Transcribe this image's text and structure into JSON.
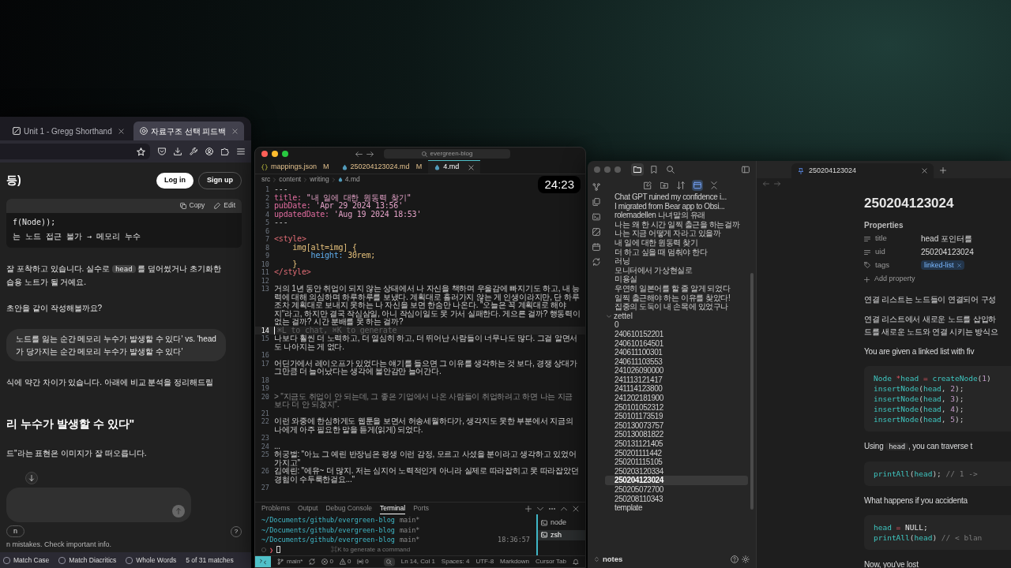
{
  "browser": {
    "tabs": [
      {
        "kind": "document",
        "title": "Unit 1 - Gregg Shorthand",
        "selected": false
      },
      {
        "kind": "chat",
        "title": "자료구조 선택 피드백",
        "selected": true
      }
    ],
    "chat_title": "등)",
    "header_buttons": [
      {
        "kind": "primary",
        "label": "Log in"
      },
      {
        "kind": "secondary",
        "label": "Sign up"
      }
    ],
    "conversation": [
      {
        "kind": "code_block",
        "actions": [
          {
            "kind": "copy",
            "label": "Copy"
          },
          {
            "kind": "edit",
            "label": "Edit"
          }
        ],
        "lines": [
          "f(Node));",
          "는 노드 접근 불가 → 메모리 누수"
        ]
      },
      {
        "kind": "paragraph",
        "lines": [
          [
            {
              "kind": "text",
              "text": "잘 포착하고 있습니다. 실수로 "
            },
            {
              "kind": "code",
              "text": "head"
            },
            {
              "kind": "text",
              "text": " 를 덮어썼거나 초기화한"
            }
          ],
          [
            {
              "kind": "text",
              "text": "습용 노트가 될 거예요."
            }
          ]
        ]
      },
      {
        "kind": "paragraph",
        "lines": [
          [
            {
              "kind": "text",
              "text": "초안을 같이 작성해볼까요?"
            }
          ]
        ]
      },
      {
        "kind": "user_bubble",
        "lines": [
          "노드를 잃는 순간 메모리 누수가 발생할 수 있다' vs. 'head",
          "가 당가지는 순간 메모리 누수가 발생할 수 있다'"
        ]
      },
      {
        "kind": "paragraph",
        "lines": [
          [
            {
              "kind": "text",
              "text": "식에 약간 차이가 있습니다. 아래에 비교 분석을 정리해드릴"
            }
          ]
        ]
      },
      {
        "kind": "heading",
        "lines": [
          "리 누수가 발생할 수 있다\""
        ]
      },
      {
        "kind": "paragraph",
        "lines": [
          [
            {
              "kind": "text",
              "text": "드\"라는 표현은 이미지가 잘 떠오릅니다."
            }
          ]
        ]
      }
    ],
    "composer_option": "n",
    "help_button": "?",
    "disclaimer": "n mistakes. Check important info.",
    "find_bar": {
      "options": [
        {
          "label": "Match Case",
          "checked": false
        },
        {
          "label": "Match Diacritics",
          "checked": false
        },
        {
          "label": "Whole Words",
          "checked": false
        }
      ],
      "status": "5 of 31 matches"
    }
  },
  "editor": {
    "search": "evergreen-blog",
    "tabs": [
      {
        "kind": "json",
        "label": "mappings.json",
        "badge": "M",
        "selected": false
      },
      {
        "kind": "markdown",
        "label": "250204123024.md",
        "badge": "M",
        "selected": false
      },
      {
        "kind": "markdown",
        "label": "4.md",
        "selected": true
      }
    ],
    "timer": "24:23",
    "breadcrumb": [
      {
        "kind": "folder",
        "label": "src"
      },
      {
        "kind": "folder",
        "label": "content"
      },
      {
        "kind": "folder",
        "label": "writing"
      },
      {
        "kind": "markdown",
        "label": "4.md"
      }
    ],
    "lines": [
      {
        "number": "1",
        "current": false,
        "tokens": [
          {
            "kind": "punct",
            "text": "---"
          }
        ]
      },
      {
        "number": "2",
        "current": false,
        "tokens": [
          {
            "kind": "key",
            "text": "title: "
          },
          {
            "kind": "string",
            "text": "\"내 일에 대한 원동력 찾기\""
          }
        ]
      },
      {
        "number": "3",
        "current": false,
        "tokens": [
          {
            "kind": "key",
            "text": "pubDate: "
          },
          {
            "kind": "string",
            "text": "'Apr 29 2024 13:56'"
          }
        ]
      },
      {
        "number": "4",
        "current": false,
        "tokens": [
          {
            "kind": "key",
            "text": "updatedDate: "
          },
          {
            "kind": "string",
            "text": "'Aug 19 2024 18:53'"
          }
        ]
      },
      {
        "number": "5",
        "current": false,
        "tokens": [
          {
            "kind": "punct",
            "text": "---"
          }
        ]
      },
      {
        "number": "6",
        "current": false
      },
      {
        "number": "7",
        "current": false,
        "tokens": [
          {
            "kind": "tag",
            "text": "<style>"
          }
        ]
      },
      {
        "number": "8",
        "current": false,
        "tokens": [
          {
            "kind": "selector",
            "text": "    img[alt=img] {"
          }
        ]
      },
      {
        "number": "9",
        "current": false,
        "tokens": [
          {
            "kind": "property",
            "text": "        height: "
          },
          {
            "kind": "value",
            "text": "30rem;"
          }
        ]
      },
      {
        "number": "10",
        "current": false,
        "tokens": [
          {
            "kind": "selector",
            "text": "    }"
          }
        ]
      },
      {
        "number": "11",
        "current": false,
        "tokens": [
          {
            "kind": "tag",
            "text": "</style>"
          }
        ]
      },
      {
        "number": "12",
        "current": false
      },
      {
        "number": "13",
        "current": false,
        "tokens": [
          {
            "kind": "text",
            "text": "거의 1년 동안 취업이 되지 않는 상태에서 나 자신을 책하며 우울감에 빠지기도 하고, 내 능력에 대해 의심하며 하루하루를 보냈다. 계획대로 흘러가지 않는 게 인생이라지만, 단 하루조차 계획대로 보내지 못하는 나 자신을 보면 한숨만 나온다. \"오늘은 꼭 계획대로 해야지\"라고, 하지만 결국 작심삼일, 아니 작심이일도 못 가서 실패한다. 게으른 걸까? 행동력이 없는 걸까? 시간 분배를 못 하는 걸까?"
          }
        ]
      },
      {
        "number": "14",
        "current": true,
        "tokens": [
          {
            "kind": "hint",
            "text": "⌘L to chat, ⌘K to generate"
          }
        ]
      },
      {
        "number": "15",
        "current": false,
        "tokens": [
          {
            "kind": "text",
            "text": "나보다 훨씬 더 노력하고, 더 열심히 하고, 더 뛰어난 사람들이 너무나도 많다. 그걸 알면서도 나아지는 게 없다."
          }
        ]
      },
      {
        "number": "16",
        "current": false
      },
      {
        "number": "17",
        "current": false,
        "tokens": [
          {
            "kind": "text",
            "text": "어딘가에서 레이오프가 있었다는 얘기를 들으면 그 이유를 생각하는 것 보다, 경쟁 상대가 그만큼 더 늘어났다는 생각에 불안감만 늘어간다."
          }
        ]
      },
      {
        "number": "18",
        "current": false
      },
      {
        "number": "19",
        "current": false
      },
      {
        "number": "20",
        "current": false,
        "tokens": [
          {
            "kind": "quote",
            "text": "> \"지금도 취업이 안 되는데, 그 좋은 기업에서 나온 사람들이 취업하려고 하면 나는 지금보다 더 안 되겠지\"."
          }
        ]
      },
      {
        "number": "21",
        "current": false
      },
      {
        "number": "22",
        "current": false,
        "tokens": [
          {
            "kind": "text",
            "text": "이런 와중에 한심하게도 웹툰을 보면서 허송세월하다가, 생각지도 못한 부분에서 지금의 나에게 아주 필요한 말을 듣게(읽게) 되었다."
          }
        ]
      },
      {
        "number": "23",
        "current": false
      },
      {
        "number": "24",
        "current": false,
        "tokens": [
          {
            "kind": "text",
            "text": "..."
          }
        ]
      },
      {
        "number": "25",
        "current": false,
        "tokens": [
          {
            "kind": "text",
            "text": "허궁벌: \"아뇨 그 예린 반장님은 평생 이런 감정, 모르고 사셨을 분이라고 생각하고 있었어 가지고\""
          }
        ]
      },
      {
        "number": "26",
        "current": false,
        "tokens": [
          {
            "kind": "text",
            "text": "김예린: \"에유~ 더 많지. 저는 심지어 노력적인게 아니라 실제로 따라잡히고 못 따라잡았던 경험이 수두룩한걸요...\""
          }
        ]
      },
      {
        "number": "27",
        "current": false
      }
    ],
    "panel_tabs": [
      {
        "label": "Problems",
        "selected": false
      },
      {
        "label": "Output",
        "selected": false
      },
      {
        "label": "Debug Console",
        "selected": false
      },
      {
        "label": "Terminal",
        "selected": true
      },
      {
        "label": "Ports",
        "selected": false
      }
    ],
    "terminal": {
      "prompts": [
        {
          "path": "~/Documents/github/evergreen-blog",
          "branch": "main*"
        },
        {
          "path": "~/Documents/github/evergreen-blog",
          "branch": "main*"
        },
        {
          "path": "~/Documents/github/evergreen-blog",
          "branch": "main*"
        }
      ],
      "time": "18:36:57",
      "prompt_symbol": "❯",
      "hint": "⌘K to generate a command",
      "sessions": [
        {
          "label": "node",
          "selected": false
        },
        {
          "label": "zsh",
          "selected": true
        }
      ]
    },
    "status_bar": {
      "branch": "main*",
      "indicators": [
        {
          "kind": "error",
          "count": "0"
        },
        {
          "kind": "warning",
          "count": "0"
        },
        {
          "kind": "ports",
          "count": "0"
        }
      ],
      "items": [
        "Ln 14, Col 1",
        "Spaces: 4",
        "UTF-8",
        "Markdown",
        "Cursor Tab"
      ]
    }
  },
  "notes": {
    "sidebar_tabs": [
      {
        "kind": "files",
        "selected": true
      },
      {
        "kind": "bookmarks",
        "selected": false
      },
      {
        "kind": "search",
        "selected": false
      }
    ],
    "file_toolbar": [
      {
        "kind": "new_note",
        "active": false
      },
      {
        "kind": "new_folder",
        "active": false
      },
      {
        "kind": "sort",
        "active": false
      },
      {
        "kind": "reveal",
        "active": true
      },
      {
        "kind": "collapse",
        "active": false
      }
    ],
    "tree": [
      {
        "kind": "continued",
        "children": [
          {
            "kind": "file",
            "name": "Chat GPT ruined my confidence i...",
            "selected": false
          },
          {
            "kind": "file",
            "name": "I migrated from Bear app to Obsi...",
            "selected": false
          },
          {
            "kind": "file",
            "name": "rolemadellen 나녀말의 유래",
            "selected": false
          },
          {
            "kind": "file",
            "name": "나는 왜 한 시간 일찍 출근을 하는걸까",
            "selected": false
          },
          {
            "kind": "file",
            "name": "나는 지금 어떻게 자라고 있을까",
            "selected": false
          },
          {
            "kind": "file",
            "name": "내 일에 대한 원동력 찾기",
            "selected": false
          },
          {
            "kind": "file",
            "name": "더 하고 싶을 때 멈춰야 한다",
            "selected": false
          },
          {
            "kind": "file",
            "name": "러닝",
            "selected": false
          },
          {
            "kind": "file",
            "name": "모니터에서 가상현실로",
            "selected": false
          },
          {
            "kind": "file",
            "name": "미용실",
            "selected": false
          },
          {
            "kind": "file",
            "name": "우연히 일본어를 할 줄 알게 되었다",
            "selected": false
          },
          {
            "kind": "file",
            "name": "일찍 출근해야 하는 이유를 찾았다!",
            "selected": false
          },
          {
            "kind": "file",
            "name": "집중의 도둑이 내 손목에 있었구나",
            "selected": false
          }
        ]
      },
      {
        "kind": "folder",
        "name": "zettel",
        "expanded": true,
        "children": [
          {
            "kind": "file",
            "name": "0",
            "selected": false
          },
          {
            "kind": "file",
            "name": "240610152201",
            "selected": false
          },
          {
            "kind": "file",
            "name": "240610164501",
            "selected": false
          },
          {
            "kind": "file",
            "name": "240611100301",
            "selected": false
          },
          {
            "kind": "file",
            "name": "240611103553",
            "selected": false
          },
          {
            "kind": "file",
            "name": "241026090000",
            "selected": false
          },
          {
            "kind": "file",
            "name": "241113121417",
            "selected": false
          },
          {
            "kind": "file",
            "name": "241114123800",
            "selected": false
          },
          {
            "kind": "file",
            "name": "241202181900",
            "selected": false
          },
          {
            "kind": "file",
            "name": "250101052312",
            "selected": false
          },
          {
            "kind": "file",
            "name": "250101173519",
            "selected": false
          },
          {
            "kind": "file",
            "name": "250130073757",
            "selected": false
          },
          {
            "kind": "file",
            "name": "250130081822",
            "selected": false
          },
          {
            "kind": "file",
            "name": "250131121405",
            "selected": false
          },
          {
            "kind": "file",
            "name": "250201111442",
            "selected": false
          },
          {
            "kind": "file",
            "name": "250201115105",
            "selected": false
          },
          {
            "kind": "file",
            "name": "250203120334",
            "selected": false
          },
          {
            "kind": "file",
            "name": "250204123024",
            "selected": true
          },
          {
            "kind": "file",
            "name": "250205072700",
            "selected": false
          },
          {
            "kind": "file",
            "name": "250208110343",
            "selected": false
          },
          {
            "kind": "file",
            "name": "template",
            "selected": false
          }
        ]
      }
    ],
    "vault": "notes",
    "tab": {
      "title": "250204123024"
    },
    "note": {
      "title": "250204123024",
      "properties_label": "Properties",
      "properties": [
        {
          "kind": "text",
          "key": "title",
          "value": "head 포인터를"
        },
        {
          "kind": "text",
          "key": "uid",
          "value": "250204123024"
        },
        {
          "kind": "tags",
          "key": "tags",
          "tags": [
            "linked-list"
          ]
        }
      ],
      "add_property": "Add property",
      "blocks": [
        {
          "kind": "paragraph",
          "lines": [
            [
              {
                "kind": "text",
                "text": "연결 리스트는 노드들이 연결되어 구성"
              }
            ]
          ]
        },
        {
          "kind": "paragraph",
          "lines": [
            [
              {
                "kind": "text",
                "text": "연결 리스트에서 새로운 노드를 삽입하"
              }
            ],
            [
              {
                "kind": "text",
                "text": "드를 새로운 노드와 연결 시키는 방식으"
              }
            ]
          ]
        },
        {
          "kind": "paragraph",
          "lines": [
            [
              {
                "kind": "text",
                "text": "You are given a linked list with fiv"
              }
            ]
          ]
        },
        {
          "kind": "code",
          "lines": [
            [
              {
                "kind": "ident",
                "text": "Node "
              },
              {
                "kind": "op",
                "text": "*"
              },
              {
                "kind": "ident",
                "text": "head "
              },
              {
                "kind": "op",
                "text": "= "
              },
              {
                "kind": "ident",
                "text": "createNode"
              },
              {
                "kind": "punct",
                "text": "("
              },
              {
                "kind": "num",
                "text": "1"
              },
              {
                "kind": "punct",
                "text": ")"
              }
            ],
            [
              {
                "kind": "ident",
                "text": "insertNode"
              },
              {
                "kind": "punct",
                "text": "("
              },
              {
                "kind": "ident",
                "text": "head"
              },
              {
                "kind": "punct",
                "text": ", "
              },
              {
                "kind": "num",
                "text": "2"
              },
              {
                "kind": "punct",
                "text": ");"
              }
            ],
            [
              {
                "kind": "ident",
                "text": "insertNode"
              },
              {
                "kind": "punct",
                "text": "("
              },
              {
                "kind": "ident",
                "text": "head"
              },
              {
                "kind": "punct",
                "text": ", "
              },
              {
                "kind": "num",
                "text": "3"
              },
              {
                "kind": "punct",
                "text": ");"
              }
            ],
            [
              {
                "kind": "ident",
                "text": "insertNode"
              },
              {
                "kind": "punct",
                "text": "("
              },
              {
                "kind": "ident",
                "text": "head"
              },
              {
                "kind": "punct",
                "text": ", "
              },
              {
                "kind": "num",
                "text": "4"
              },
              {
                "kind": "punct",
                "text": ");"
              }
            ],
            [
              {
                "kind": "ident",
                "text": "insertNode"
              },
              {
                "kind": "punct",
                "text": "("
              },
              {
                "kind": "ident",
                "text": "head"
              },
              {
                "kind": "punct",
                "text": ", "
              },
              {
                "kind": "num",
                "text": "5"
              },
              {
                "kind": "punct",
                "text": ");"
              }
            ]
          ]
        },
        {
          "kind": "paragraph",
          "lines": [
            [
              {
                "kind": "text",
                "text": "Using "
              },
              {
                "kind": "code",
                "text": "head"
              },
              {
                "kind": "text",
                "text": ", you can traverse t"
              }
            ]
          ]
        },
        {
          "kind": "code",
          "lines": [
            [
              {
                "kind": "ident",
                "text": "printAll"
              },
              {
                "kind": "punct",
                "text": "("
              },
              {
                "kind": "ident",
                "text": "head"
              },
              {
                "kind": "punct",
                "text": "); "
              },
              {
                "kind": "comment",
                "text": "// 1 ->"
              }
            ]
          ]
        },
        {
          "kind": "paragraph",
          "lines": [
            [
              {
                "kind": "text",
                "text": "What happens if you accidenta"
              }
            ]
          ]
        },
        {
          "kind": "code",
          "lines": [
            [
              {
                "kind": "ident",
                "text": "head "
              },
              {
                "kind": "op",
                "text": "= "
              },
              {
                "kind": "plain",
                "text": "NULL;"
              }
            ],
            [
              {
                "kind": "ident",
                "text": "printAll"
              },
              {
                "kind": "punct",
                "text": "("
              },
              {
                "kind": "ident",
                "text": "head"
              },
              {
                "kind": "punct",
                "text": ") "
              },
              {
                "kind": "comment",
                "text": "// < blan"
              }
            ]
          ]
        },
        {
          "kind": "paragraph",
          "lines": [
            [
              {
                "kind": "text",
                "text": "Now, you've lost"
              }
            ]
          ]
        }
      ]
    }
  }
}
